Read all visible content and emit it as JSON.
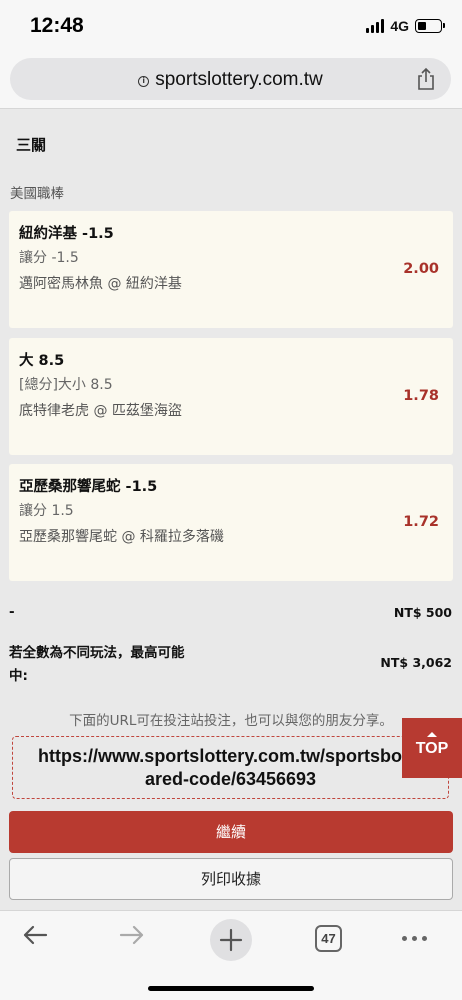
{
  "status_bar": {
    "time": "12:48",
    "network": "4G",
    "battery_level_percent": 40
  },
  "browser": {
    "url": "sportslottery.com.tw",
    "open_tabs": "47"
  },
  "bet_slip": {
    "section_title": "三關",
    "league": "美國職棒",
    "bets": [
      {
        "selection": "紐約洋基 -1.5",
        "market": "讓分 -1.5",
        "match": "邁阿密馬林魚 @ 紐約洋基",
        "odds": "2.00"
      },
      {
        "selection": "大 8.5",
        "market": "[總分]大小 8.5",
        "match": "底特律老虎 @ 匹茲堡海盜",
        "odds": "1.78"
      },
      {
        "selection": "亞歷桑那響尾蛇 -1.5",
        "market": "讓分 1.5",
        "match": "亞歷桑那響尾蛇 @ 科羅拉多落磯",
        "odds": "1.72"
      }
    ],
    "stake_label": "-",
    "stake_value": "NT$ 500",
    "max_win_label_line1": "若全數為不同玩法，最高可能",
    "max_win_label_line2": "中:",
    "max_win_value": "NT$ 3,062",
    "share_note": "下面的URL可在投注站投注，也可以與您的朋友分享。",
    "share_url_line1": "https://www.sportslottery.com.tw/sportsbook",
    "share_url_line2": "ared-code/63456693",
    "top_label": "TOP",
    "continue_label": "繼續",
    "print_label": "列印收據"
  },
  "colors": {
    "accent": "#b83a30",
    "odds": "#a8322a",
    "card_bg": "#fbf9ef"
  }
}
